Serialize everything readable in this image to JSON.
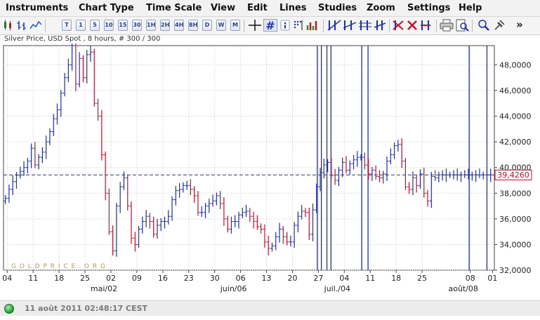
{
  "menu": [
    "Instruments",
    "Chart Type",
    "Time Scale",
    "View",
    "Edit",
    "Lines",
    "Studies",
    "Zoom",
    "Settings",
    "Help"
  ],
  "toolbar": {
    "timeframes": [
      "T",
      "1",
      "5",
      "10",
      "15",
      "30",
      "1H",
      "2H",
      "4H",
      "8H",
      "D",
      "W",
      "M"
    ],
    "more_label": "»"
  },
  "chart_header": "Silver Price, USD Spot , 8 hours, # 300 / 300",
  "watermark": "G O L D P R I C E . O R G",
  "status": {
    "timestamp": "11 août 2011 02:48:17 CEST"
  },
  "colors": {
    "up_bar": "#1b2fb8",
    "down_bar": "#c8102e",
    "price_line": "#1b2fb8",
    "current_price_label": "#c8102e",
    "vertical_lines": "#1b2fb8"
  },
  "chart_data": {
    "type": "line",
    "title": "Silver Price, USD Spot , 8 hours, # 300 / 300",
    "xlabel": "",
    "ylabel": "",
    "ylim": [
      32000,
      49500
    ],
    "y_ticks": [
      "32,0000",
      "34,0000",
      "36,0000",
      "38,0000",
      "40,0000",
      "42,0000",
      "44,0000",
      "46,0000",
      "48,0000"
    ],
    "y_tick_values": [
      32000,
      34000,
      36000,
      38000,
      40000,
      42000,
      44000,
      46000,
      48000
    ],
    "current_price": 39426,
    "current_price_label": "39,4260",
    "x_ticks": [
      "04",
      "11",
      "18",
      "25",
      "02",
      "09",
      "16",
      "23",
      "30",
      "06",
      "13",
      "20",
      "27",
      "04",
      "11",
      "18",
      "25",
      "08"
    ],
    "x_tick_pos": [
      0.5,
      7.5,
      14.5,
      21.5,
      28.5,
      35.5,
      42.5,
      49.5,
      56.5,
      63.5,
      70.5,
      77.5,
      84.5,
      91.5,
      98.5,
      105.5,
      112.5,
      125.5
    ],
    "x_minor_ticks": [
      "01"
    ],
    "x_minor_tick_pos": [
      131.5
    ],
    "month_labels": [
      "mai/02",
      "juin/06",
      "juil./04",
      "août/08"
    ],
    "month_label_pos": [
      28.5,
      63.5,
      91.5,
      125.5
    ],
    "x_range": [
      -0.5,
      132
    ],
    "vertical_markers": [
      84.2,
      85.3,
      86.8,
      87.9,
      96.2,
      97.9,
      125.2,
      130.0
    ],
    "x": [
      0,
      1,
      2,
      3,
      4,
      5,
      6,
      7,
      8,
      9,
      10,
      11,
      12,
      13,
      14,
      15,
      16,
      17,
      18,
      19,
      20,
      21,
      22,
      23,
      24,
      25,
      26,
      27,
      28,
      29,
      30,
      31,
      32,
      33,
      34,
      35,
      36,
      37,
      38,
      39,
      40,
      41,
      42,
      43,
      44,
      45,
      46,
      47,
      48,
      49,
      50,
      51,
      52,
      53,
      54,
      55,
      56,
      57,
      58,
      59,
      60,
      61,
      62,
      63,
      64,
      65,
      66,
      67,
      68,
      69,
      70,
      71,
      72,
      73,
      74,
      75,
      76,
      77,
      78,
      79,
      80,
      81,
      82,
      83,
      84,
      85,
      86,
      87,
      88,
      89,
      90,
      91,
      92,
      93,
      94,
      95,
      96,
      97,
      98,
      99,
      100,
      101,
      102,
      103,
      104,
      105,
      106,
      107,
      108,
      109,
      110,
      111,
      112,
      113,
      114,
      115,
      116,
      117,
      118,
      119,
      120,
      121,
      122,
      123,
      124,
      125,
      126,
      127,
      128,
      129,
      130,
      131
    ],
    "y": [
      37600,
      38300,
      38900,
      39400,
      39700,
      40000,
      40500,
      41500,
      40200,
      40800,
      41200,
      42000,
      42800,
      43800,
      44500,
      45800,
      47000,
      48000,
      49500,
      46500,
      48500,
      47000,
      48800,
      49000,
      45000,
      44000,
      41000,
      38000,
      35000,
      33500,
      37000,
      38500,
      39200,
      37000,
      34500,
      34000,
      35200,
      35800,
      36200,
      35800,
      34800,
      35500,
      35800,
      35800,
      36200,
      37500,
      38200,
      38300,
      38600,
      38600,
      38300,
      37800,
      36500,
      36500,
      37000,
      37200,
      37400,
      37800,
      37200,
      36000,
      35200,
      35800,
      35800,
      36300,
      36500,
      36600,
      36200,
      35800,
      35400,
      35200,
      34200,
      33700,
      33900,
      34600,
      35200,
      34600,
      34200,
      34200,
      35500,
      36200,
      36600,
      36500,
      34800,
      36700,
      38500,
      39600,
      40200,
      40400,
      39400,
      39000,
      39800,
      40400,
      39800,
      40300,
      40600,
      40800,
      40800,
      40200,
      39500,
      39800,
      39300,
      39200,
      39500,
      40500,
      41000,
      41700,
      41800,
      40500,
      38500,
      38300,
      39200,
      38600,
      39500,
      38000,
      37400,
      39300,
      39200,
      39426,
      39426,
      39426,
      39426,
      39426,
      39426,
      39426,
      39426,
      39426,
      39426,
      39426,
      39426,
      39426,
      39426,
      39426
    ]
  }
}
